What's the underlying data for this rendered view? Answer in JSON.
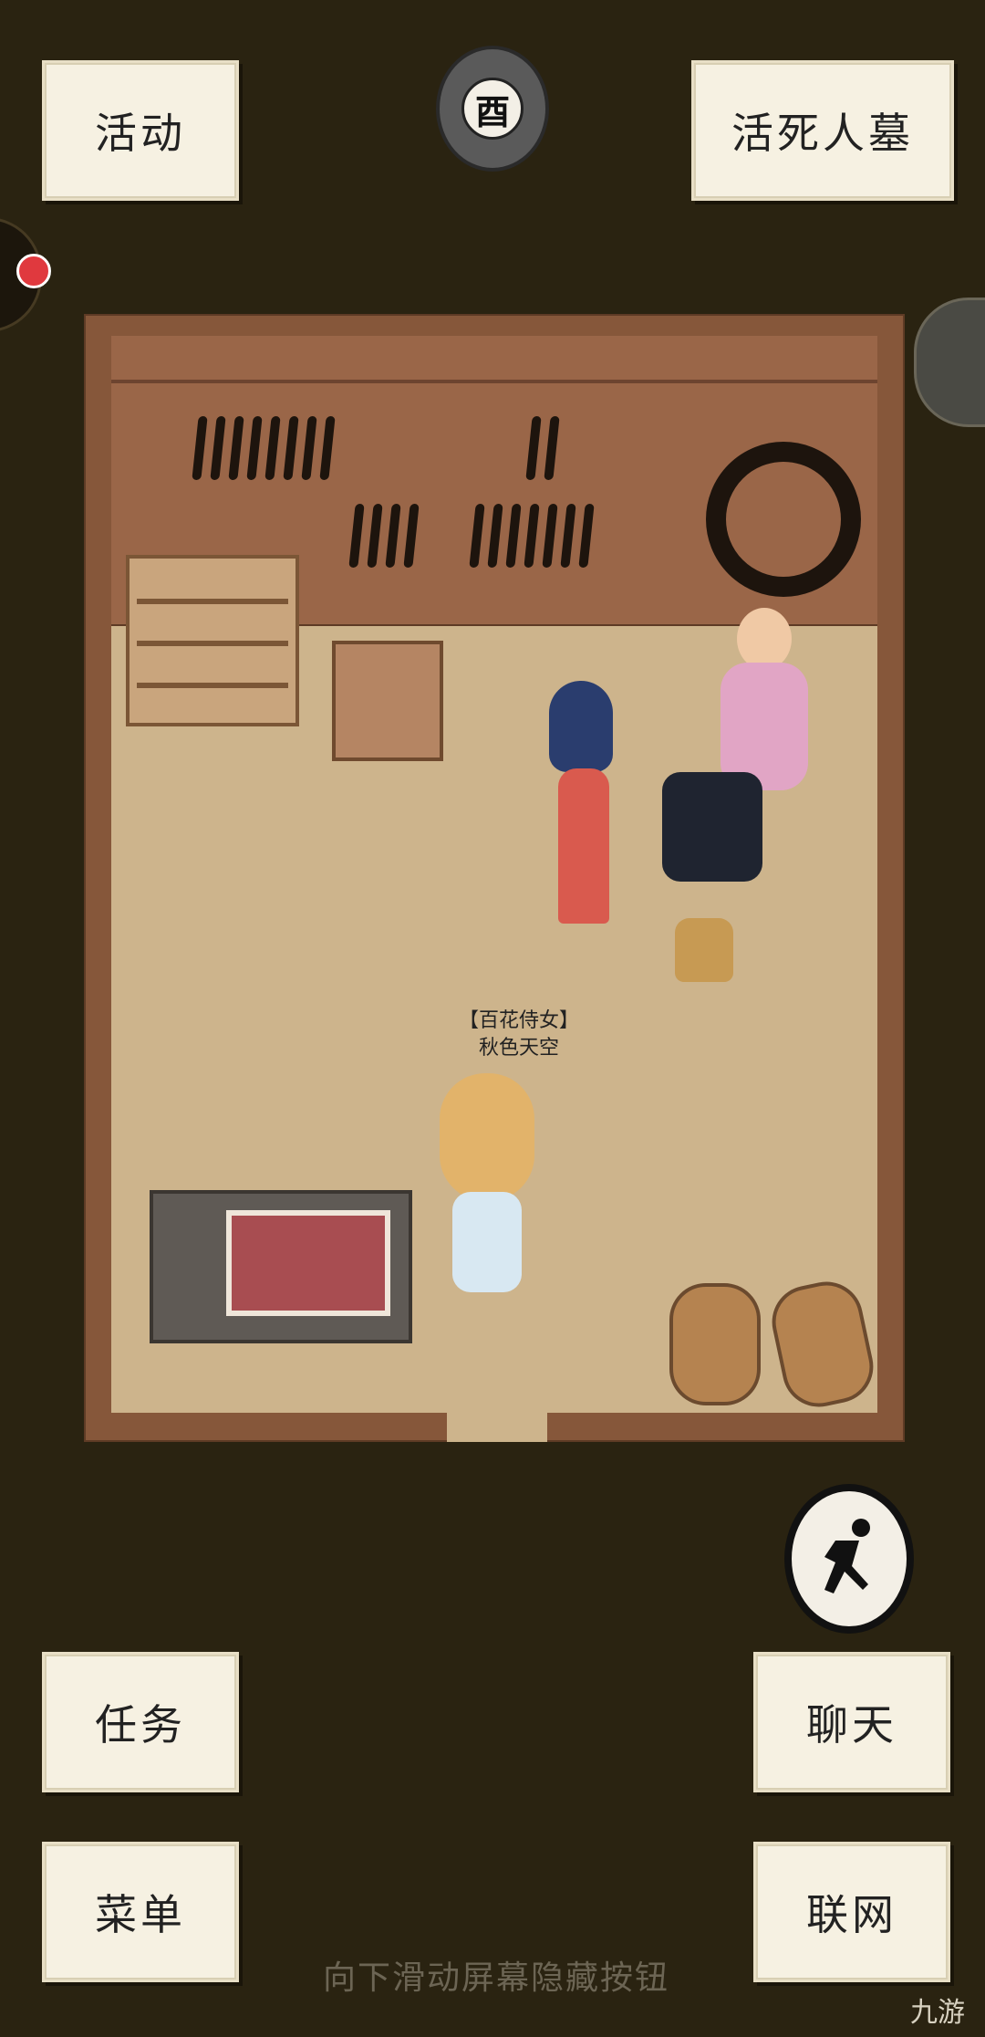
{
  "top_bar": {
    "activity_label": "活动",
    "time_label": "酉",
    "location_label": "活死人墓"
  },
  "room": {
    "player_title": "【百花侍女】",
    "player_name": "秋色天空"
  },
  "bottom_bar": {
    "task_label": "任务",
    "chat_label": "聊天",
    "menu_label": "菜单",
    "network_label": "联网",
    "hint": "向下滑动屏幕隐藏按钮"
  },
  "watermark": "九游",
  "colors": {
    "background": "#2a2311",
    "button_bg": "#f6f1e2",
    "room_wall": "#9a6648",
    "room_floor": "#cdb48c"
  }
}
